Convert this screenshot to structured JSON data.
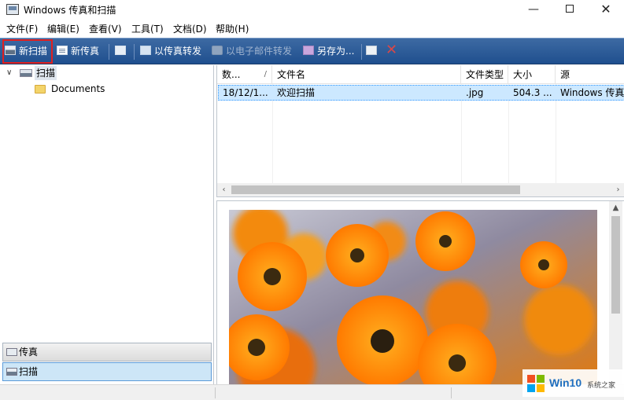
{
  "window": {
    "title": "Windows 传真和扫描",
    "minimize_glyph": "—",
    "close_glyph": "✕"
  },
  "menu": [
    "文件(F)",
    "编辑(E)",
    "查看(V)",
    "工具(T)",
    "文档(D)",
    "帮助(H)"
  ],
  "toolbar": {
    "new_scan": "新扫描",
    "new_fax": "新传真",
    "forward_as_fax": "以传真转发",
    "forward_as_email": "以电子邮件转发",
    "save_as": "另存为...",
    "delete_glyph": "✕",
    "highlight_color": "#e02020"
  },
  "tree": {
    "root_label": "扫描",
    "toggle_glyph": "∨",
    "children": [
      "Documents"
    ]
  },
  "nav": {
    "fax_label": "传真",
    "scan_label": "扫描",
    "active": "扫描"
  },
  "list": {
    "columns": [
      "数...",
      "文件名",
      "文件类型",
      "大小",
      "源"
    ],
    "sort_glyph": "/",
    "rows": [
      {
        "date": "18/12/1...",
        "name": "欢迎扫描",
        "type": ".jpg",
        "size": "504.3 ...",
        "source": "Windows 传真"
      }
    ],
    "selected_row_color": "#cce8ff"
  },
  "scrollbars": {
    "left_arrow": "‹",
    "right_arrow": "›",
    "up_arrow": "▲",
    "down_arrow": "▼"
  },
  "preview": {
    "subject": "orange gerbera daisy flowers photo"
  },
  "watermark": {
    "brand": "Win10",
    "site": "系统之家"
  },
  "colors": {
    "toolbar_gradient_top": "#3d6aa3",
    "toolbar_gradient_bottom": "#1f4f8e",
    "accent": "#1f6fc0"
  }
}
